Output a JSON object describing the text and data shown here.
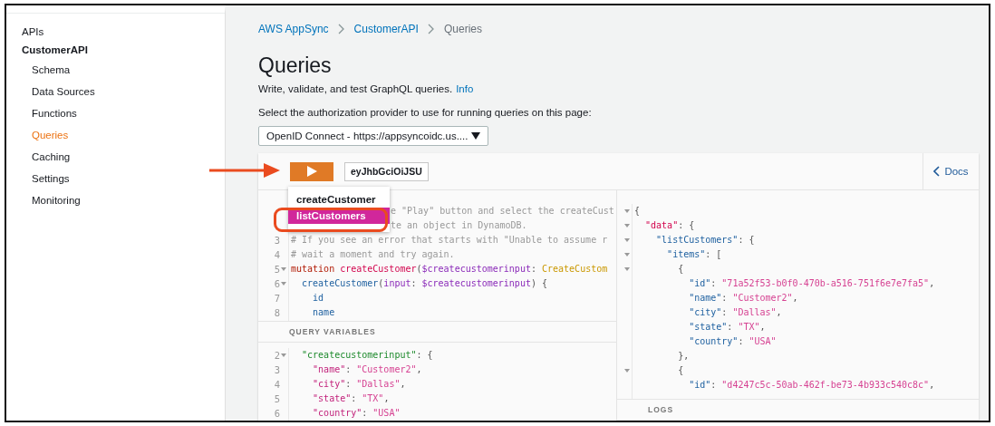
{
  "sidebar": {
    "items": [
      {
        "label": "APIs",
        "selected": false
      },
      {
        "label": "CustomerAPI",
        "selected": false,
        "children": [
          {
            "label": "Schema",
            "selected": false
          },
          {
            "label": "Data Sources",
            "selected": false
          },
          {
            "label": "Functions",
            "selected": false
          },
          {
            "label": "Queries",
            "selected": true
          },
          {
            "label": "Caching",
            "selected": false
          },
          {
            "label": "Settings",
            "selected": false
          },
          {
            "label": "Monitoring",
            "selected": false
          }
        ]
      }
    ]
  },
  "breadcrumb": [
    "AWS AppSync",
    "CustomerAPI",
    "Queries"
  ],
  "title": "Queries",
  "description": "Write, validate, and test GraphQL queries.",
  "info_link": "Info",
  "auth_label": "Select the authorization provider to use for running queries on this page:",
  "auth_select": "OpenID Connect - https://appsyncoidc.us....",
  "toolbar": {
    "token": "eyJhbGciOiJSU",
    "docs": "Docs"
  },
  "run_menu": [
    {
      "label": "createCustomer",
      "selected": false
    },
    {
      "label": "listCustomers",
      "selected": true
    }
  ],
  "query_lines": [
    {
      "kind": "covered",
      "foldable": false,
      "tokens": [
        {
          "text": "e \"Play\" button and select the createCust",
          "kind": "comment"
        }
      ]
    },
    {
      "kind": "covered",
      "foldable": false,
      "tokens": [
        {
          "text": "te an object in DynamoDB.",
          "kind": "comment"
        }
      ]
    },
    {
      "kind": "code",
      "number": "3",
      "foldable": false,
      "tokens": [
        {
          "text": "# If you see an error that starts with \"Unable to assume r",
          "kind": "comment"
        }
      ]
    },
    {
      "kind": "code",
      "number": "4",
      "foldable": false,
      "tokens": [
        {
          "text": "# wait a moment and try again.",
          "kind": "comment"
        }
      ]
    },
    {
      "kind": "code",
      "number": "5",
      "foldable": true,
      "tokens": [
        {
          "text": "mutation ",
          "kind": "keyword"
        },
        {
          "text": "createCustomer",
          "kind": "def"
        },
        {
          "text": "(",
          "kind": "punct"
        },
        {
          "text": "$createcustomerinput",
          "kind": "variable"
        },
        {
          "text": ": ",
          "kind": "punct"
        },
        {
          "text": "CreateCustom",
          "kind": "type"
        }
      ]
    },
    {
      "kind": "code",
      "number": "6",
      "foldable": true,
      "tokens": [
        {
          "text": "  createCustomer",
          "kind": "field"
        },
        {
          "text": "(",
          "kind": "punct"
        },
        {
          "text": "input",
          "kind": "variable"
        },
        {
          "text": ": ",
          "kind": "punct"
        },
        {
          "text": "$createcustomerinput",
          "kind": "variable"
        },
        {
          "text": ") {",
          "kind": "punct"
        }
      ]
    },
    {
      "kind": "code",
      "number": "7",
      "foldable": false,
      "tokens": [
        {
          "text": "    id",
          "kind": "property"
        }
      ]
    },
    {
      "kind": "code",
      "number": "8",
      "foldable": false,
      "tokens": [
        {
          "text": "    name",
          "kind": "property"
        }
      ]
    }
  ],
  "variables_header": "QUERY VARIABLES",
  "variable_lines": [
    {
      "kind": "code",
      "number": "2",
      "foldable": true,
      "tokens": [
        {
          "text": "  \"createcustomerinput\"",
          "kind": "objkey"
        },
        {
          "text": ": {",
          "kind": "punct"
        }
      ]
    },
    {
      "kind": "code",
      "number": "3",
      "foldable": false,
      "tokens": [
        {
          "text": "    \"name\"",
          "kind": "key"
        },
        {
          "text": ": ",
          "kind": "punct"
        },
        {
          "text": "\"Customer2\"",
          "kind": "string"
        },
        {
          "text": ",",
          "kind": "punct"
        }
      ]
    },
    {
      "kind": "code",
      "number": "4",
      "foldable": false,
      "tokens": [
        {
          "text": "    \"city\"",
          "kind": "key"
        },
        {
          "text": ": ",
          "kind": "punct"
        },
        {
          "text": "\"Dallas\"",
          "kind": "string"
        },
        {
          "text": ",",
          "kind": "punct"
        }
      ]
    },
    {
      "kind": "code",
      "number": "5",
      "foldable": false,
      "tokens": [
        {
          "text": "    \"state\"",
          "kind": "key"
        },
        {
          "text": ": ",
          "kind": "punct"
        },
        {
          "text": "\"TX\"",
          "kind": "string"
        },
        {
          "text": ",",
          "kind": "punct"
        }
      ]
    },
    {
      "kind": "code",
      "number": "6",
      "foldable": false,
      "tokens": [
        {
          "text": "    \"country\"",
          "kind": "key"
        },
        {
          "text": ": ",
          "kind": "punct"
        },
        {
          "text": "\"USA\"",
          "kind": "string"
        }
      ]
    }
  ],
  "result_lines": [
    {
      "kind": "code",
      "foldable": true,
      "tokens": [
        {
          "text": "{",
          "kind": "punct"
        }
      ]
    },
    {
      "kind": "code",
      "foldable": true,
      "tokens": [
        {
          "text": "  \"data\"",
          "kind": "def"
        },
        {
          "text": ": {",
          "kind": "punct"
        }
      ]
    },
    {
      "kind": "code",
      "foldable": true,
      "tokens": [
        {
          "text": "    \"listCustomers\"",
          "kind": "property"
        },
        {
          "text": ": {",
          "kind": "punct"
        }
      ]
    },
    {
      "kind": "code",
      "foldable": true,
      "tokens": [
        {
          "text": "      \"items\"",
          "kind": "property"
        },
        {
          "text": ": [",
          "kind": "punct"
        }
      ]
    },
    {
      "kind": "code",
      "foldable": true,
      "tokens": [
        {
          "text": "        {",
          "kind": "punct"
        }
      ]
    },
    {
      "kind": "code",
      "foldable": false,
      "tokens": [
        {
          "text": "          \"id\"",
          "kind": "property"
        },
        {
          "text": ": ",
          "kind": "punct"
        },
        {
          "text": "\"71a52f53-b0f0-470b-a516-751f6e7e7fa5\"",
          "kind": "string"
        },
        {
          "text": ",",
          "kind": "punct"
        }
      ]
    },
    {
      "kind": "code",
      "foldable": false,
      "tokens": [
        {
          "text": "          \"name\"",
          "kind": "property"
        },
        {
          "text": ": ",
          "kind": "punct"
        },
        {
          "text": "\"Customer2\"",
          "kind": "string"
        },
        {
          "text": ",",
          "kind": "punct"
        }
      ]
    },
    {
      "kind": "code",
      "foldable": false,
      "tokens": [
        {
          "text": "          \"city\"",
          "kind": "property"
        },
        {
          "text": ": ",
          "kind": "punct"
        },
        {
          "text": "\"Dallas\"",
          "kind": "string"
        },
        {
          "text": ",",
          "kind": "punct"
        }
      ]
    },
    {
      "kind": "code",
      "foldable": false,
      "tokens": [
        {
          "text": "          \"state\"",
          "kind": "property"
        },
        {
          "text": ": ",
          "kind": "punct"
        },
        {
          "text": "\"TX\"",
          "kind": "string"
        },
        {
          "text": ",",
          "kind": "punct"
        }
      ]
    },
    {
      "kind": "code",
      "foldable": false,
      "tokens": [
        {
          "text": "          \"country\"",
          "kind": "property"
        },
        {
          "text": ": ",
          "kind": "punct"
        },
        {
          "text": "\"USA\"",
          "kind": "string"
        }
      ]
    },
    {
      "kind": "code",
      "foldable": false,
      "tokens": [
        {
          "text": "        },",
          "kind": "punct"
        }
      ]
    },
    {
      "kind": "code",
      "foldable": true,
      "tokens": [
        {
          "text": "        {",
          "kind": "punct"
        }
      ]
    },
    {
      "kind": "code",
      "foldable": false,
      "tokens": [
        {
          "text": "          \"id\"",
          "kind": "property"
        },
        {
          "text": ": ",
          "kind": "punct"
        },
        {
          "text": "\"d4247c5c-50ab-462f-be73-4b933c540c8c\"",
          "kind": "string"
        },
        {
          "text": ",",
          "kind": "punct"
        }
      ]
    }
  ],
  "logs_header": "LOGS"
}
